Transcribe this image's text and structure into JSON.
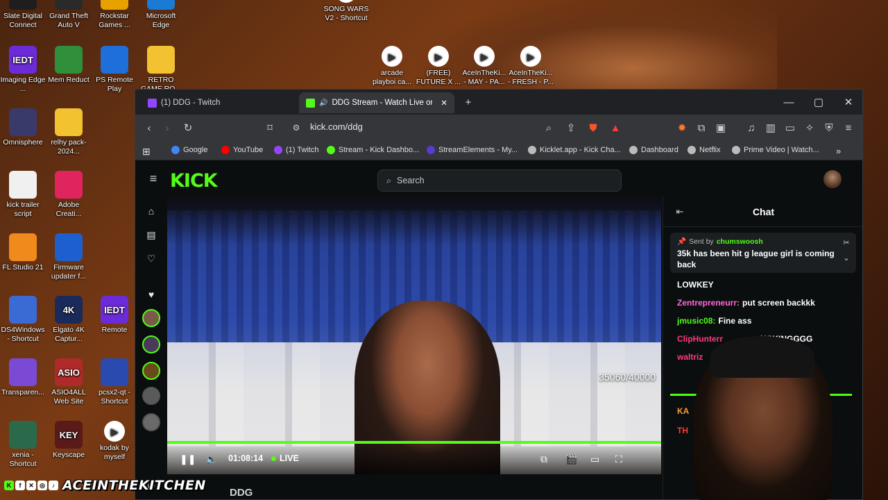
{
  "desktop": {
    "icons": [
      {
        "label": "Slate Digital Connect",
        "color": "#1e1e1e"
      },
      {
        "label": "Grand Theft Auto V",
        "color": "#2a2a2a"
      },
      {
        "label": "Rockstar Games ...",
        "color": "#e8a200"
      },
      {
        "label": "Microsoft Edge",
        "color": "#1a7ad4"
      },
      {
        "label": "SONG WARS V2 - Shortcut",
        "color": "#ffffff"
      },
      {
        "label": "Imaging Edge ...",
        "glyph": "IEDT",
        "color": "#6c2bd9"
      },
      {
        "label": "Mem Reduct",
        "color": "#2f8f3a"
      },
      {
        "label": "PS Remote Play",
        "color": "#1e6fd9"
      },
      {
        "label": "RETRO GAME RO...",
        "color": "#f2c230"
      },
      {
        "label": "arcade playboi ca...",
        "color": "#ffffff"
      },
      {
        "label": "(FREE) FUTURE X ...",
        "color": "#ffffff"
      },
      {
        "label": "AceInTheKi... - MAY - PA...",
        "color": "#ffffff"
      },
      {
        "label": "AceInTheKi... - FRESH - P...",
        "color": "#ffffff"
      },
      {
        "label": "Omnisphere",
        "color": "#3a3a6a"
      },
      {
        "label": "relhy pack-2024...",
        "color": "#f2c230"
      },
      {
        "label": "kick trailer script",
        "color": "#f0f0f0"
      },
      {
        "label": "Adobe Creati...",
        "color": "#e0245e"
      },
      {
        "label": "FL Studio 21",
        "color": "#f08a1c"
      },
      {
        "label": "Firmware updater f...",
        "color": "#1e5fd0"
      },
      {
        "label": "DS4Windows - Shortcut",
        "color": "#3a6ad4"
      },
      {
        "label": "Elgato 4K Captur...",
        "glyph": "4K",
        "color": "#1a2a5a"
      },
      {
        "label": "Remote",
        "glyph": "IEDT",
        "color": "#6c2bd9"
      },
      {
        "label": "Transparen...",
        "color": "#7a4ad4"
      },
      {
        "label": "ASIO4ALL Web Site",
        "glyph": "ASIO",
        "color": "#b02a2a"
      },
      {
        "label": "pcsx2-qt - Shortcut",
        "color": "#2a4ab0"
      },
      {
        "label": "xenia - Shortcut",
        "color": "#2a6a4a"
      },
      {
        "label": "Keyscape",
        "glyph": "KEY",
        "color": "#5a1a1a"
      },
      {
        "label": "kodak by myself",
        "color": "#ffffff"
      }
    ]
  },
  "browser": {
    "tabs": [
      {
        "label": "(1) DDG - Twitch",
        "color": "#9146ff"
      },
      {
        "label": "DDG Stream - Watch Live on Kic",
        "color": "#53fc18"
      }
    ],
    "url": "kick.com/ddg",
    "bookmarks": [
      {
        "label": "Google",
        "color": "#4285f4"
      },
      {
        "label": "YouTube",
        "color": "#ff0000"
      },
      {
        "label": "(1) Twitch",
        "color": "#9146ff"
      },
      {
        "label": "Stream - Kick Dashbo...",
        "color": "#53fc18"
      },
      {
        "label": "StreamElements - My...",
        "color": "#5a3ad4"
      },
      {
        "label": "Kicklet.app - Kick Cha...",
        "color": "#bbbbbb"
      },
      {
        "label": "Dashboard",
        "color": "#bbbbbb"
      },
      {
        "label": "Netflix",
        "color": "#bbbbbb"
      },
      {
        "label": "Prime Video | Watch...",
        "color": "#bbbbbb"
      }
    ]
  },
  "kick": {
    "logo": "KICK",
    "search_placeholder": "Search",
    "player": {
      "viewer_goal": "35060/40000",
      "time": "01:08:14",
      "live_label": "LIVE"
    },
    "streamer_name": "DDG",
    "chat": {
      "title": "Chat",
      "pinned_prefix": "Sent by",
      "pinned_user": "chumswoosh",
      "pinned_message": "35k has been hit g league girl is coming back",
      "messages": [
        {
          "user": "",
          "text": "LOWKEY",
          "color": "#ffffff"
        },
        {
          "user": "Zentrepreneurr:",
          "text": "put screen backkk",
          "color": "#ff6ad5"
        },
        {
          "user": "jmusic08:",
          "text": "Fine ass",
          "color": "#53fc18"
        },
        {
          "user": "ClipHunterr",
          "text": "UCKINGGGG",
          "color": "#ff3a7a"
        },
        {
          "user": "waltriz",
          "text": "",
          "color": "#ff3a7a"
        },
        {
          "user": "KA",
          "text": "",
          "color": "#ff9a3a"
        },
        {
          "user": "TH",
          "text": "",
          "color": "#ff3a3a"
        }
      ]
    }
  },
  "overlay": {
    "social_icons": [
      "kick-icon",
      "facebook-icon",
      "twitter-icon",
      "instagram-icon",
      "tiktok-icon"
    ],
    "handle": "ACEINTHEKITCHEN"
  }
}
